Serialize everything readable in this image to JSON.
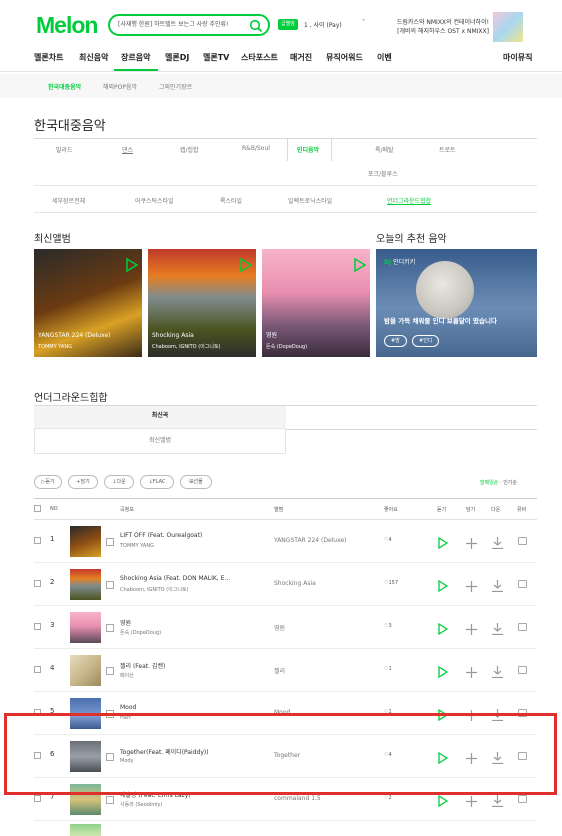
{
  "header": {
    "logo": "Melon",
    "search_query": "[사재행 한원] 하트텔트 보는그 사랑 추인류!",
    "ticket_badge": "급별양",
    "user_name": "1 , 사이 (Pay)",
    "user_caret": "˅",
    "ad_text_1": "드림카스와 NMIXX의 컨테이너하이!",
    "ad_text_2": "[개비의 해지하우스 OST x NMIXX]"
  },
  "gnb": {
    "items": [
      "멜론차트",
      "최신음악",
      "장르음악",
      "멜론DJ",
      "멜론TV",
      "스타포스트",
      "매거진",
      "뮤직어워드",
      "이벤"
    ],
    "my_music": "마이뮤직",
    "active_index": 2
  },
  "subnav": {
    "items": [
      "한국대중음악",
      "해외POP음악",
      "그외인기장르"
    ],
    "active_index": 0
  },
  "page_title": "한국대중음악",
  "genre_tabs": {
    "row1": [
      "발라드",
      "댄스",
      "랩/힙합",
      "R&B/Soul",
      "인디음악",
      "록/메탈",
      "트로트"
    ],
    "row2": [
      "포크/블루스"
    ],
    "active": "인디음악"
  },
  "subgenres": {
    "items": [
      "세부장르전체",
      "어쿠스틱스타일",
      "록스타일",
      "일렉트로닉스타일",
      "언더그라운드힙합"
    ],
    "active_index": 4
  },
  "latest_albums": {
    "heading": "최신앨범",
    "items": [
      {
        "title": "YANGSTAR 224 (Deluxe)",
        "artist": "TOMMY YANG"
      },
      {
        "title": "Shocking Asia",
        "artist": "Chaboom, IGNITO (이그니토)"
      },
      {
        "title": "영원",
        "artist": "돈숙 (DopeDoug)"
      }
    ]
  },
  "recommend": {
    "heading": "오늘의 추천 음악",
    "dj_label": "DJ",
    "dj_name": "인디키키",
    "description": "밤을 가득 채워줄 인디 보름달이 떴습니다",
    "tags": [
      "#밤",
      "#인디"
    ]
  },
  "underground": {
    "heading": "언더그라운드힙합",
    "tab_songs": "최신곡",
    "tab_albums": "최신앨범"
  },
  "toolbar": {
    "buttons": [
      "듣기",
      "담기",
      "다운",
      "FLAC",
      "선물"
    ],
    "sort_active": "발매일순",
    "sort_other": "인기순"
  },
  "table": {
    "headers": [
      "NO",
      "곡정보",
      "앨범",
      "좋아요",
      "듣기",
      "담기",
      "다운",
      "뮤비"
    ],
    "rows": [
      {
        "no": "1",
        "title": "LIFT OFF (Feat. Ourealgoat)",
        "artist": "TOMMY YANG",
        "album": "YANGSTAR 224 (Deluxe)",
        "likes": "4"
      },
      {
        "no": "2",
        "title": "Shocking Asia (Feat. DON MALIK, E...",
        "artist": "Chaboom, IGNITO (이그니토)",
        "album": "Shocking Asia",
        "likes": "157"
      },
      {
        "no": "3",
        "title": "영원",
        "artist": "돈숙 (DopeDoug)",
        "album": "영원",
        "likes": "3"
      },
      {
        "no": "4",
        "title": "젤리 (Feat. 김켄)",
        "artist": "메이산",
        "album": "젤리",
        "likes": "1"
      },
      {
        "no": "5",
        "title": "Mood",
        "artist": "Hart",
        "album": "Mood",
        "likes": "1"
      },
      {
        "no": "6",
        "title": "Together(Feat. 페이디(Paiddy))",
        "artist": "Mody",
        "album": "Together",
        "likes": "4"
      },
      {
        "no": "7",
        "title": "예술빵 (Feat. Chris Lazy)",
        "artist": "사동라 (Seodimly)",
        "album": "commaland 1.5",
        "likes": "2"
      }
    ]
  },
  "colors": {
    "accent": "#00cd3c",
    "highlight": "#e0302b"
  }
}
